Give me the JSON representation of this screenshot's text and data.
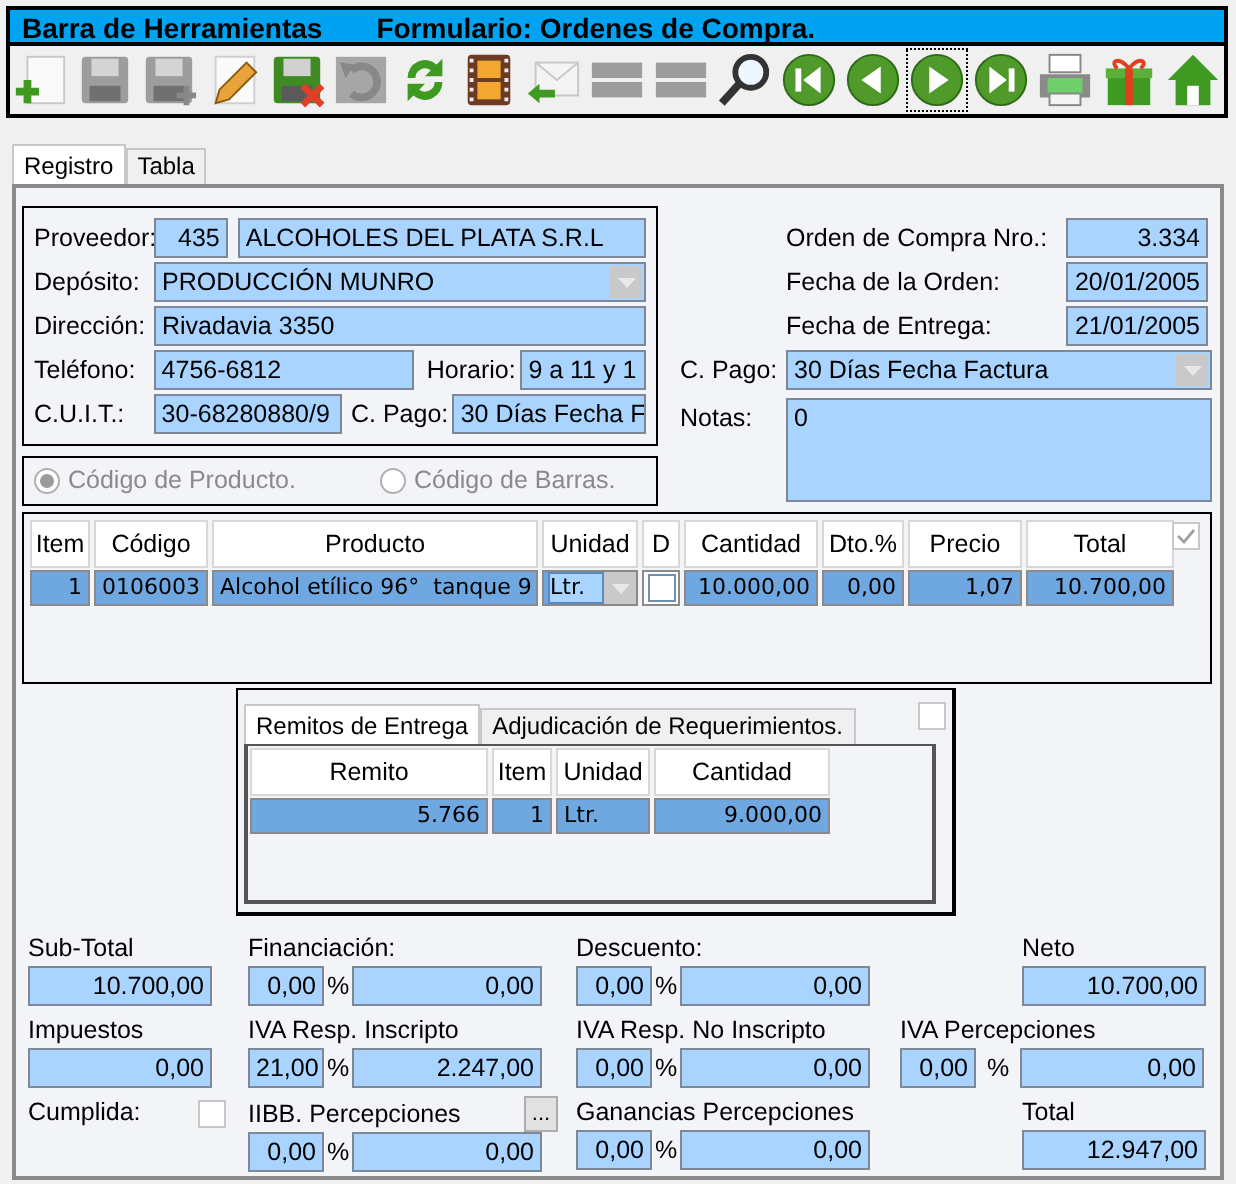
{
  "title_bar": {
    "toolbar_title": "Barra de Herramientas",
    "form_title": "Formulario: Ordenes de Compra."
  },
  "toolbar": [
    {
      "kind": "new",
      "disabled": false,
      "focused": false
    },
    {
      "kind": "save",
      "disabled": true,
      "focused": false
    },
    {
      "kind": "save_as",
      "disabled": true,
      "focused": false
    },
    {
      "kind": "edit",
      "disabled": false,
      "focused": false
    },
    {
      "kind": "discard",
      "disabled": false,
      "focused": false
    },
    {
      "kind": "undo",
      "disabled": true,
      "focused": false
    },
    {
      "kind": "refresh",
      "disabled": false,
      "focused": false
    },
    {
      "kind": "film",
      "disabled": false,
      "focused": false
    },
    {
      "kind": "reply",
      "disabled": false,
      "focused": false
    },
    {
      "kind": "list",
      "disabled": true,
      "focused": false
    },
    {
      "kind": "list",
      "disabled": true,
      "focused": false
    },
    {
      "kind": "search",
      "disabled": false,
      "focused": false
    },
    {
      "kind": "first",
      "disabled": false,
      "focused": false
    },
    {
      "kind": "prev",
      "disabled": false,
      "focused": false
    },
    {
      "kind": "next",
      "disabled": false,
      "focused": true
    },
    {
      "kind": "last",
      "disabled": false,
      "focused": false
    },
    {
      "kind": "print",
      "disabled": false,
      "focused": false
    },
    {
      "kind": "gift",
      "disabled": false,
      "focused": false
    },
    {
      "kind": "home",
      "disabled": false,
      "focused": false
    }
  ],
  "tabs": [
    {
      "label": "Registro",
      "selected": true
    },
    {
      "label": "Tabla",
      "selected": false
    }
  ],
  "supplier": {
    "proveedor_label": "Proveedor:",
    "proveedor_code": "435",
    "proveedor_name": "ALCOHOLES DEL PLATA S.R.L",
    "deposito_label": "Depósito:",
    "deposito": "PRODUCCIÓN MUNRO",
    "direccion_label": "Dirección:",
    "direccion": "Rivadavia 3350",
    "telefono_label": "Teléfono:",
    "telefono": "4756-6812",
    "horario_label": "Horario:",
    "horario": "9 a 11 y 1",
    "cuit_label": "C.U.I.T.:",
    "cuit": "30-68280880/9",
    "pago_label": "C. Pago:",
    "pago": "30 Días Fecha F"
  },
  "order": {
    "fields": [
      {
        "label": "Orden de Compra Nro.:",
        "value": "3.334"
      },
      {
        "label": "Fecha de la Orden:",
        "value": "20/01/2005"
      },
      {
        "label": "Fecha de Entrega:",
        "value": "21/01/2005"
      }
    ],
    "pago_label": "C. Pago:",
    "pago": "30 Días Fecha Factura",
    "notas_label": "Notas:",
    "notas": "0"
  },
  "code_mode": {
    "disabled": true,
    "options": [
      {
        "label": "Código de Producto.",
        "selected": true
      },
      {
        "label": "Código de Barras.",
        "selected": false
      }
    ]
  },
  "items_table": {
    "columns": [
      "Item",
      "Código",
      "Producto",
      "Unidad",
      "D",
      "Cantidad",
      "Dto.%",
      "Precio",
      "Total"
    ],
    "all_checked": true,
    "rows": [
      {
        "item": "1",
        "codigo": "0106003",
        "producto": "Alcohol etílico 96°  tanque 9",
        "unidad": "Ltr.",
        "d": false,
        "cantidad": "10.000,00",
        "dto": "0,00",
        "precio": "1,07",
        "total": "10.700,00"
      }
    ]
  },
  "delivery": {
    "tabs": [
      {
        "label": "Remitos de Entrega",
        "selected": true
      },
      {
        "label": "Adjudicación de Requerimientos.",
        "selected": false
      }
    ],
    "checked": false,
    "columns": [
      "Remito",
      "Item",
      "Unidad",
      "Cantidad"
    ],
    "rows": [
      {
        "remito": "5.766",
        "item": "1",
        "unidad": "Ltr.",
        "cantidad": "9.000,00"
      }
    ]
  },
  "totals": [
    [
      {
        "kind": "amount",
        "label": "Sub-Total",
        "amount": "10.700,00"
      },
      {
        "kind": "percent",
        "label": "Financiación:",
        "percent": "0,00",
        "percent_sign": "%",
        "amount": "0,00"
      },
      {
        "kind": "percent",
        "label": "Descuento:",
        "percent": "0,00",
        "percent_sign": "%",
        "amount": "0,00"
      },
      {
        "kind": "amount",
        "label": "Neto",
        "amount": "10.700,00"
      }
    ],
    [
      {
        "kind": "amount",
        "label": "Impuestos",
        "amount": "0,00"
      },
      {
        "kind": "percent",
        "label": "IVA Resp. Inscripto",
        "percent": "21,00",
        "percent_sign": "%",
        "amount": "2.247,00"
      },
      {
        "kind": "percent",
        "label": "IVA Resp. No Inscripto",
        "percent": "0,00",
        "percent_sign": "%",
        "amount": "0,00"
      },
      {
        "kind": "percent",
        "label": "IVA Percepciones",
        "percent": "0,00",
        "percent_sign": "%",
        "amount": "0,00"
      }
    ],
    [
      {
        "kind": "check",
        "label": "Cumplida:",
        "checked": false
      },
      {
        "kind": "percent",
        "label": "IIBB. Percepciones",
        "button": "...",
        "percent": "0,00",
        "percent_sign": "%",
        "amount": "0,00"
      },
      {
        "kind": "percent",
        "label": "Ganancias Percepciones",
        "percent": "0,00",
        "percent_sign": "%",
        "amount": "0,00"
      },
      {
        "kind": "amount",
        "label": "Total",
        "amount": "12.947,00"
      }
    ]
  ]
}
